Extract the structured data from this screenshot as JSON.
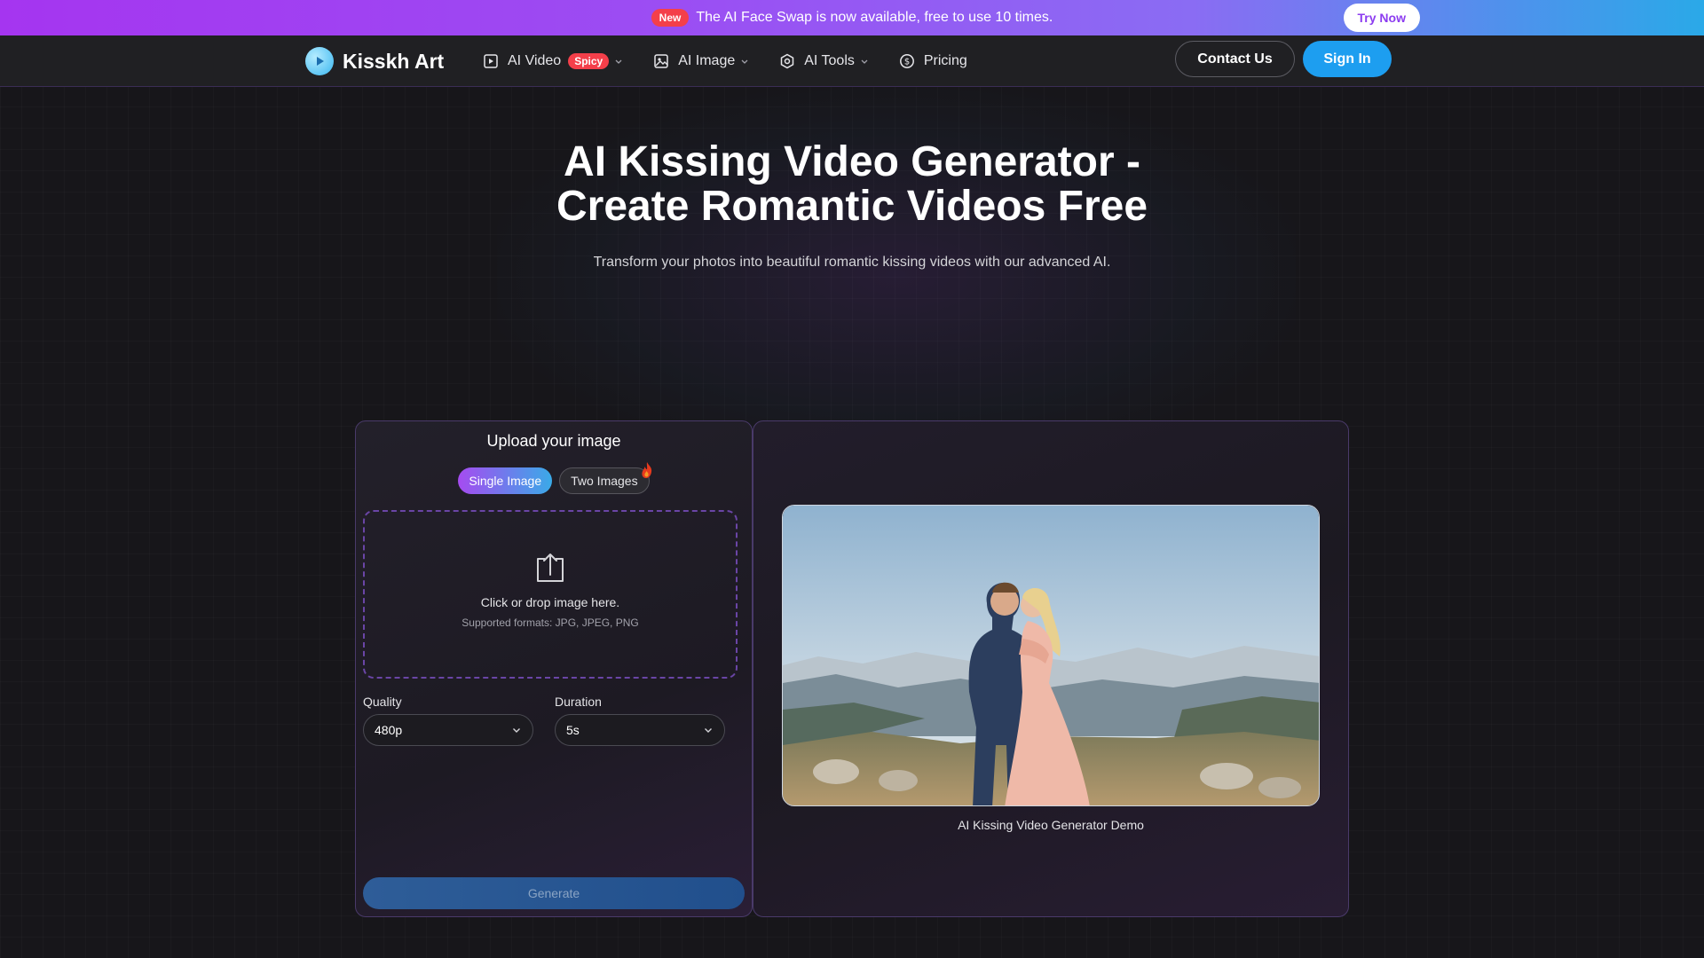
{
  "announcement": {
    "badge": "New",
    "message": "The AI Face Swap is now available, free to use 10 times.",
    "cta": "Try Now"
  },
  "brand": {
    "name": "Kisskh Art"
  },
  "nav": {
    "items": [
      {
        "label": "AI Video",
        "badge": "Spicy",
        "icon": "video-icon",
        "dropdown": true
      },
      {
        "label": "AI Image",
        "icon": "image-icon",
        "dropdown": true
      },
      {
        "label": "AI Tools",
        "icon": "tools-icon",
        "dropdown": true
      },
      {
        "label": "Pricing",
        "icon": "dollar-icon",
        "dropdown": false
      }
    ],
    "contact": "Contact Us",
    "signin": "Sign In"
  },
  "hero": {
    "title_line1": "AI Kissing Video Generator -",
    "title_line2": "Create Romantic Videos Free",
    "subtitle": "Transform your photos into beautiful romantic kissing videos with our advanced AI."
  },
  "upload": {
    "title": "Upload your image",
    "tabs": [
      {
        "label": "Single Image",
        "active": true
      },
      {
        "label": "Two Images",
        "active": false
      }
    ],
    "dropzone": {
      "main": "Click or drop image here.",
      "formats": "Supported formats: JPG, JPEG, PNG"
    },
    "quality": {
      "label": "Quality",
      "value": "480p"
    },
    "duration": {
      "label": "Duration",
      "value": "5s"
    },
    "generate": "Generate"
  },
  "demo": {
    "caption": "AI Kissing Video Generator Demo"
  },
  "colors": {
    "accent_purple": "#a64bf0",
    "accent_blue": "#1d9ef0",
    "badge_red": "#f43f4a",
    "background": "#17161a"
  }
}
